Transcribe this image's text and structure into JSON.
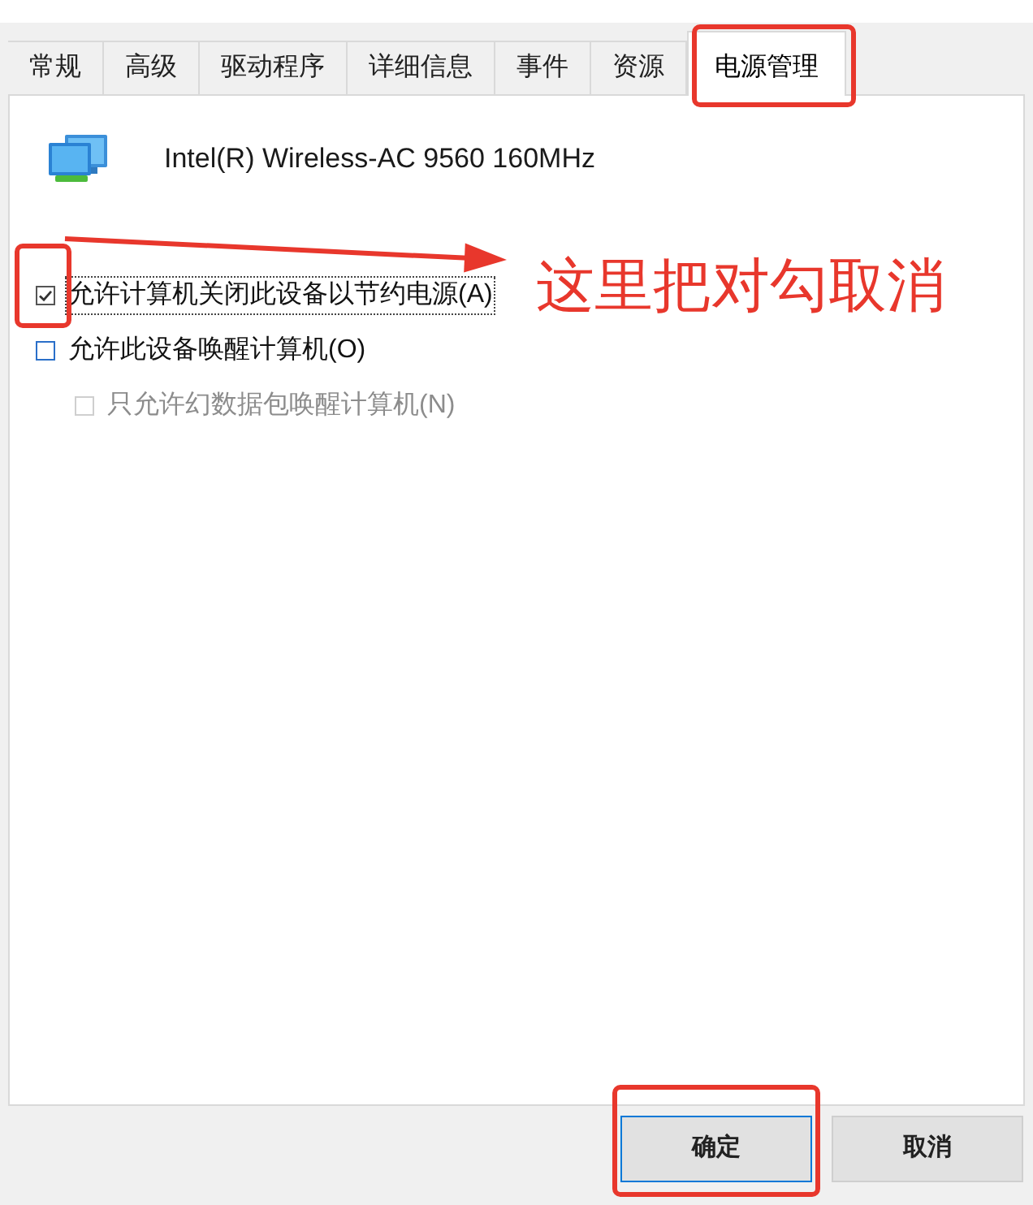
{
  "tabs": [
    {
      "label": "常规",
      "selected": false,
      "highlighted": false
    },
    {
      "label": "高级",
      "selected": false,
      "highlighted": false
    },
    {
      "label": "驱动程序",
      "selected": false,
      "highlighted": false
    },
    {
      "label": "详细信息",
      "selected": false,
      "highlighted": false
    },
    {
      "label": "事件",
      "selected": false,
      "highlighted": false
    },
    {
      "label": "资源",
      "selected": false,
      "highlighted": false
    },
    {
      "label": "电源管理",
      "selected": true,
      "highlighted": true
    }
  ],
  "device": {
    "name": "Intel(R) Wireless-AC 9560 160MHz"
  },
  "options": [
    {
      "label": "允许计算机关闭此设备以节约电源(A)",
      "checked": true,
      "disabled": false,
      "focused": true,
      "highlighted": true
    },
    {
      "label": "允许此设备唤醒计算机(O)",
      "checked": false,
      "disabled": false,
      "focused": false,
      "highlighted": false,
      "children": [
        {
          "label": "只允许幻数据包唤醒计算机(N)",
          "checked": false,
          "disabled": true,
          "focused": false,
          "highlighted": false
        }
      ]
    }
  ],
  "annotation": {
    "text": "这里把对勾取消"
  },
  "buttons": [
    {
      "label": "确定",
      "default": true,
      "highlighted": true
    },
    {
      "label": "取消",
      "default": false,
      "highlighted": false
    }
  ]
}
